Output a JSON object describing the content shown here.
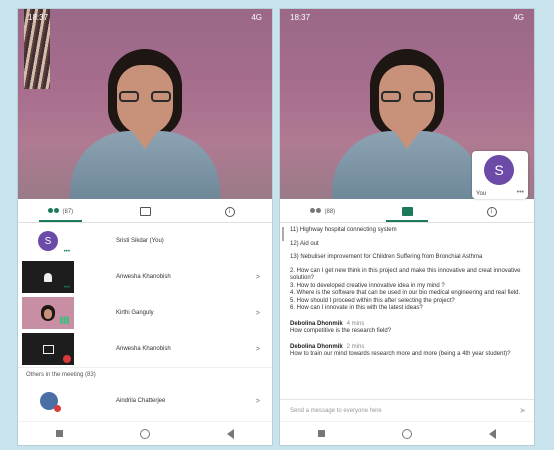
{
  "left_phone": {
    "status_time": "18:37",
    "status_right": "4G",
    "tabs": [
      {
        "label": "(87)"
      },
      {
        "label": ""
      },
      {
        "label": "i"
      }
    ],
    "participants": [
      {
        "name": "Sristi Sikdar (You)",
        "avatar_letter": "S"
      },
      {
        "name": "Anwesha Khanobish"
      },
      {
        "name": "Kirthi Ganguly"
      },
      {
        "name": "Anwesha Khanobish"
      }
    ],
    "others_heading": "Others in the meeting (83)",
    "others": [
      {
        "name": "Aindrila Chatterjee"
      }
    ]
  },
  "right_phone": {
    "status_time": "18:37",
    "status_right": "4G",
    "self_tile": {
      "letter": "S",
      "label": "You"
    },
    "tabs": [
      {
        "label": "(88)"
      },
      {
        "label": ""
      },
      {
        "label": "i"
      }
    ],
    "chat_lines": [
      "11) Highway hospital connecting system",
      "12) Aid out",
      "13) Nebuliser improvement for Children Suffering from Bronchial Asthma",
      "2. How can I get new think in this project and make this innovative and creat innovative solution?",
      "3. How to developed creative innovative idea in my mind ?",
      "4. Where is the software that can be used in our bio medical engineering and real field.",
      "5. How should I proceed within this after selecting the project?",
      "6. How can I innovate in this with the latest ideas?"
    ],
    "messages": [
      {
        "sender": "Debolina Dhonmik",
        "time": "4 mins",
        "text": "How competitive is the research field?"
      },
      {
        "sender": "Debolina Dhonmik",
        "time": "2 mins",
        "text": "How to train our mind towards research more and more (being a 4th year student)?"
      }
    ],
    "compose_placeholder": "Send a message to everyone here"
  },
  "icons": [
    "people-icon",
    "chat-icon",
    "info-icon",
    "more-icon",
    "bell-icon",
    "share-screen-icon",
    "mic-off-icon",
    "send-icon",
    "chevron-right-icon"
  ],
  "colors": {
    "accent": "#1b7a5a",
    "avatar": "#6b4aa8",
    "background": "#c9e3ec"
  }
}
